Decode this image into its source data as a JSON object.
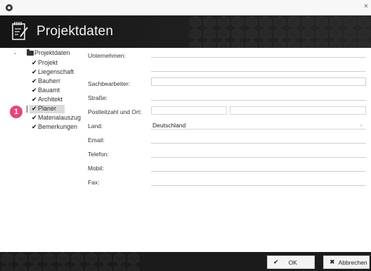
{
  "header": {
    "title": "Projektdaten"
  },
  "tree": {
    "root": "Projektdaten",
    "items": [
      "Projekt",
      "Liegenschaft",
      "Bauherr",
      "Bauamt",
      "Architekt",
      "Planer",
      "Materialauszug",
      "Bemerkungen"
    ],
    "selected": "Planer"
  },
  "badge": "1",
  "form": {
    "unternehmen_label": "Unternehmen:",
    "sachbearbeiter_label": "Sachbearbeiter:",
    "strasse_label": "Straße:",
    "plz_ort_label": "Postleitzahl und Ort:",
    "land_label": "Land:",
    "land_value": "Deutschland",
    "email_label": "Email:",
    "telefon_label": "Telefon:",
    "mobil_label": "Mobil:",
    "fax_label": "Fax:"
  },
  "buttons": {
    "ok": "OK",
    "cancel": "Abbrechen"
  },
  "colors": {
    "badge": "#e8457a",
    "header_bg": "#1e1e1e"
  },
  "icons": {
    "app": "app-logo-icon",
    "header": "edit-document-icon"
  }
}
